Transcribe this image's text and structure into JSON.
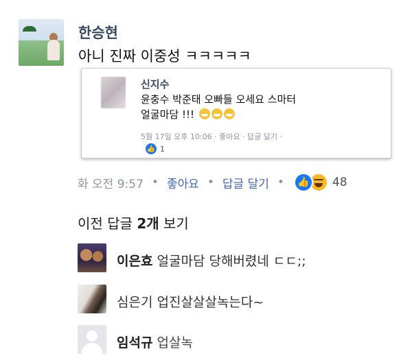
{
  "main_comment": {
    "author": "한승현",
    "text": "아니 진짜 이중성 ㅋㅋㅋㅋㅋ",
    "time": "화 오전 9:57",
    "like_label": "좋아요",
    "reply_label": "답글 달기",
    "reaction_count": "48",
    "reactions": [
      "like-icon",
      "haha-icon"
    ]
  },
  "embedded": {
    "author": "신지수",
    "text_line1": "윤충수 박준태 오빠들 오세요 스마터",
    "text_line2": "얼굴마담 !!!",
    "time": "5월 17일 오후 10:06",
    "like_label": "좋아요",
    "reply_label": "답글 달기",
    "like_count": "1"
  },
  "previous_replies_label_pre": "이전 답글 ",
  "previous_replies_count": "2개",
  "previous_replies_label_post": " 보기",
  "replies": [
    {
      "author": "이은효",
      "text": "얼굴마담 당해버렸네 ㄷㄷ;;"
    },
    {
      "author": "",
      "text": "심은기 업진살살살녹는다~"
    },
    {
      "author": "임석규",
      "text": "업살녹"
    }
  ],
  "colors": {
    "link": "#4267b2",
    "like_blue": "#1877f2",
    "meta_gray": "#90949c",
    "name": "#3b4a63"
  }
}
